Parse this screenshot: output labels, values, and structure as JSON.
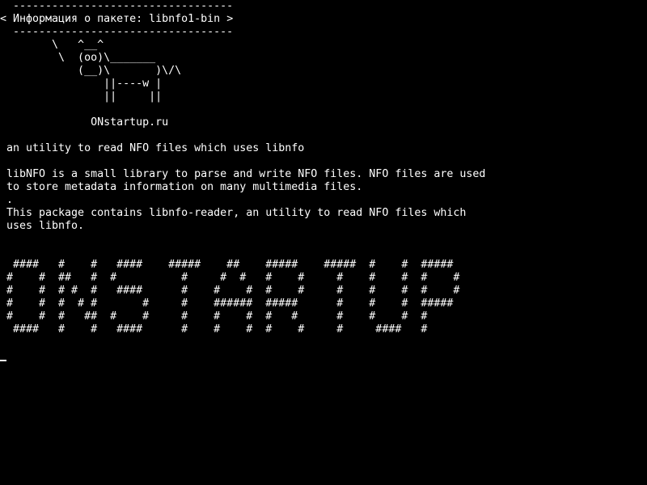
{
  "colors": {
    "background": "#000000",
    "foreground": "#ffffff"
  },
  "terminal": {
    "cowsay": {
      "border_top": " ----------------------------------",
      "title": "< Информация о пакете: libnfo1-bin >",
      "border_bottom": " ----------------------------------",
      "cow": [
        "       \\   ^__^",
        "        \\  (oo)\\_______",
        "           (__)\\       )\\/\\",
        "               ||----w |",
        "               ||     ||"
      ],
      "site": "             ONstartup.ru"
    },
    "summary": "an utility to read NFO files which uses libnfo",
    "description": [
      "libNFO is a small library to parse and write NFO files. NFO files are used",
      "to store metadata information on many multimedia files.",
      ".",
      "This package contains libnfo-reader, an utility to read NFO files which",
      "uses libnfo."
    ],
    "banner": [
      " ####   #    #   ####    #####    ##    #####    #####  #    #  #####",
      "#    #  ##   #  #          #     #  #   #    #     #    #    #  #    #",
      "#    #  # #  #   ####      #    #    #  #    #     #    #    #  #    #",
      "#    #  #  # #       #     #    ######  #####      #    #    #  #####",
      "#    #  #   ##  #    #     #    #    #  #   #      #    #    #  #",
      " ####   #    #   ####      #    #    #  #    #     #     ####   #"
    ]
  }
}
